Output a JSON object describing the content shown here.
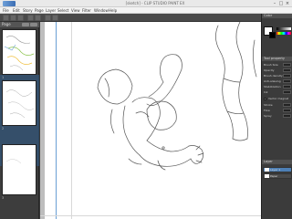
{
  "window": {
    "title": "[sketch] - CLIP STUDIO PAINT EX",
    "minimize": "–",
    "maximize": "□",
    "close": "×"
  },
  "menu": [
    "File",
    "Edit",
    "Story",
    "Page",
    "Layer",
    "Select",
    "View",
    "Filter",
    "Window",
    "Help"
  ],
  "pages_panel": {
    "label": "Page",
    "pages": [
      "1",
      "2",
      "3"
    ]
  },
  "color_panel": {
    "label": "Color",
    "main_color": "#ffffff",
    "sub_color": "#000000"
  },
  "tool_property": {
    "label": "Tool property",
    "rows": [
      "Brush Size",
      "Opacity",
      "Brush density",
      "Anti-aliasing",
      "Stabilization",
      "Ink",
      "Vector magnet",
      "Stroke",
      "Flow",
      "Spray"
    ]
  },
  "layer_panel": {
    "label": "Layer",
    "layers": [
      "Layer 1",
      "Paper"
    ]
  },
  "colors": {
    "accent": "#4d7fb5",
    "ruler": "#6a9fd4",
    "panel_bg": "#3b3b3b"
  }
}
